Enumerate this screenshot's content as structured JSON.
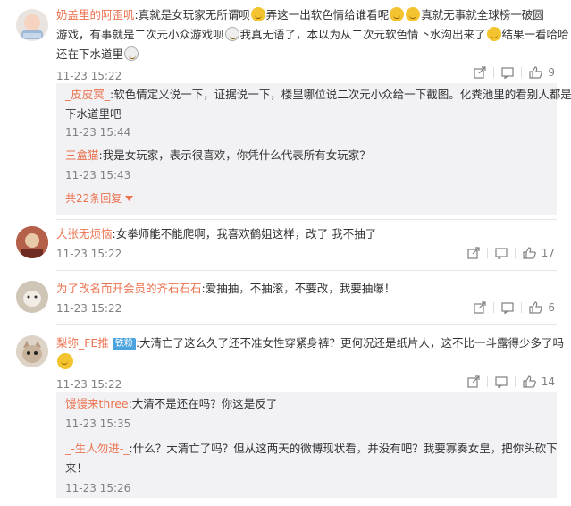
{
  "comments": [
    {
      "user": "奶盖里的阿歪叽",
      "lines": [
        "真就是女玩家无所谓呗",
        "弄这一出软色情给谁看呢",
        "真就无事就全球榜一破圆",
        "游戏，有事就是二次元小众游戏呗",
        "我真无语了，本以为从二次元软色情下水沟出来了",
        "结果一看哈哈",
        "还在下水道里"
      ],
      "time": "11-23 15:22",
      "likes": "9",
      "replies": [
        {
          "user": "_皮皮冥_",
          "text1": "软色情定义说一下，证据说一下，楼里哪位说二次元小众给一下截图。化粪池里的看别人都是",
          "text2": "下水道里吧",
          "time": "11-23 15:44"
        },
        {
          "user": "三盒猫",
          "text1": "我是女玩家，表示很喜欢，你凭什么代表所有女玩家？",
          "time": "11-23 15:43"
        }
      ],
      "more": "共22条回复"
    },
    {
      "user": "大张无烦恼",
      "text": "女拳师能不能爬啊，我喜欢鹤姐这样，改了 我不抽了",
      "time": "11-23 15:22",
      "likes": "17"
    },
    {
      "user": "为了改名而开会员的齐石石石",
      "text": "爱抽抽，不抽滚，不要改，我要抽爆！",
      "time": "11-23 15:22",
      "likes": "6"
    },
    {
      "user": "梨弥_FE推",
      "badge": "铁粉",
      "text": "大清亡了这么久了还不准女性穿紧身裤？更何况还是纸片人，这不比一斗露得少多了吗",
      "time": "11-23 15:22",
      "likes": "14",
      "replies": [
        {
          "user": "馒馒来three",
          "text1": "大清不是还在吗？你这是反了",
          "time": "11-23 15:35"
        },
        {
          "user": "_-生人勿进-_",
          "text1": "什么？大清亡了吗？但从这两天的微博现状看，并没有吧？我要寡奏女皇，把你头砍下",
          "text2": "来！",
          "time": "11-23 15:26"
        }
      ]
    }
  ],
  "colors": {
    "username": "#eb7350",
    "muted": "#808080",
    "replybg": "#f2f2f5"
  },
  "icons": [
    "share-icon",
    "comment-icon",
    "like-icon",
    "chevron-down-icon",
    "grin-emoji-icon",
    "cry-emoji-icon"
  ]
}
